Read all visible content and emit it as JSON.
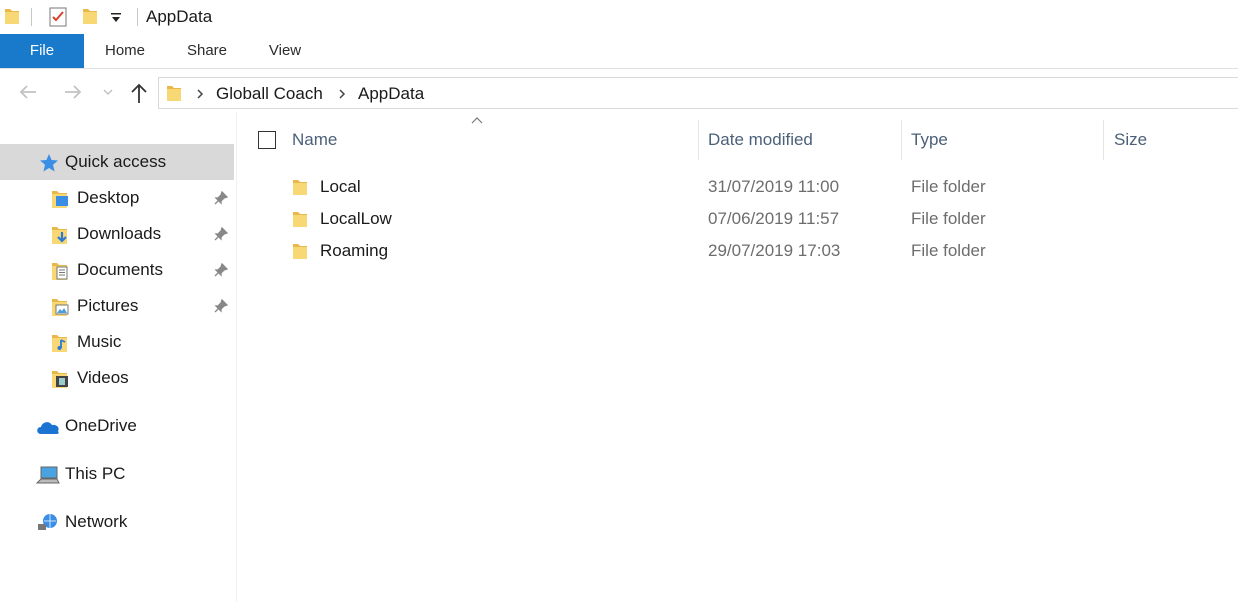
{
  "window": {
    "title": "AppData"
  },
  "quick_access_toolbar": {
    "icons": [
      "folder-icon",
      "properties-icon",
      "new-folder-icon",
      "customize-dropdown-icon"
    ]
  },
  "ribbon": {
    "tabs": [
      {
        "label": "File",
        "active": true
      },
      {
        "label": "Home"
      },
      {
        "label": "Share"
      },
      {
        "label": "View"
      }
    ]
  },
  "address_bar": {
    "crumbs": [
      "Globall Coach",
      "AppData"
    ]
  },
  "sidebar": {
    "items": [
      {
        "label": "Quick access",
        "icon": "star-icon"
      },
      {
        "label": "Desktop",
        "icon": "desktop-folder-icon",
        "pinned": true
      },
      {
        "label": "Downloads",
        "icon": "downloads-folder-icon",
        "pinned": true
      },
      {
        "label": "Documents",
        "icon": "documents-folder-icon",
        "pinned": true
      },
      {
        "label": "Pictures",
        "icon": "pictures-folder-icon",
        "pinned": true
      },
      {
        "label": "Music",
        "icon": "music-folder-icon"
      },
      {
        "label": "Videos",
        "icon": "videos-folder-icon"
      },
      {
        "label": "OneDrive",
        "icon": "onedrive-cloud-icon"
      },
      {
        "label": "This PC",
        "icon": "computer-icon"
      },
      {
        "label": "Network",
        "icon": "network-icon"
      }
    ]
  },
  "columns": {
    "name": "Name",
    "date_modified": "Date modified",
    "type": "Type",
    "size": "Size"
  },
  "files": [
    {
      "name": "Local",
      "date_modified": "31/07/2019 11:00",
      "type": "File folder"
    },
    {
      "name": "LocalLow",
      "date_modified": "07/06/2019 11:57",
      "type": "File folder"
    },
    {
      "name": "Roaming",
      "date_modified": "29/07/2019 17:03",
      "type": "File folder"
    }
  ],
  "colors": {
    "file_tab": "#1979ca",
    "folder": "#f8d775",
    "selected_sidebar": "#d9d9d9",
    "column_header_text": "#4c607a"
  }
}
